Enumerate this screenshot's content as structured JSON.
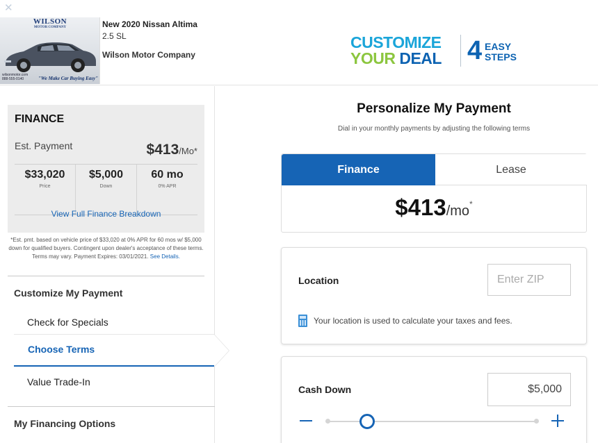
{
  "header": {
    "close_symbol": "✕",
    "dealer_logo_text": "WILSON",
    "dealer_logo_subtext": "MOTOR COMPANY",
    "dealer_site": "wilsonmotor.com",
    "dealer_phone": "888-555-0140",
    "dealer_slogan": "\"We Make Car Buying Easy\"",
    "vehicle_title": "New 2020 Nissan Altima",
    "vehicle_trim": "2.5 SL",
    "dealer_name": "Wilson Motor Company",
    "brand": {
      "customize": "CUSTOMIZE",
      "your": "YOUR",
      "deal": "DEAL",
      "four": "4",
      "easy": "EASY",
      "steps": "STEPS"
    }
  },
  "sidebar": {
    "finance_title": "FINANCE",
    "est_label": "Est. Payment",
    "est_value": "$413",
    "est_unit": "/Mo*",
    "stats": [
      {
        "value": "$33,020",
        "label": "Price"
      },
      {
        "value": "$5,000",
        "label": "Down"
      },
      {
        "value": "60 mo",
        "label": "0% APR"
      }
    ],
    "breakdown_link": "View Full Finance Breakdown",
    "disclaimer": "*Est. pmt. based on vehicle price of $33,020 at 0% APR for 60 mos w/ $5,000 down for qualified buyers. Contingent upon dealer's acceptance of these terms. Terms may vary. Payment Expires: 03/01/2021.",
    "disclaimer_link": "See Details.",
    "customize_heading": "Customize My Payment",
    "nav": {
      "specials": "Check for Specials",
      "terms": "Choose Terms",
      "tradein": "Value Trade-In"
    },
    "financing_options": "My Financing Options"
  },
  "main": {
    "title": "Personalize My Payment",
    "subtitle": "Dial in your monthly payments by adjusting the following terms",
    "tabs": {
      "finance": "Finance",
      "lease": "Lease"
    },
    "payment_value": "$413",
    "payment_unit": "/mo",
    "payment_asterisk": "*",
    "location": {
      "label": "Location",
      "zip_placeholder": "Enter ZIP",
      "note": "Your location is used to calculate your taxes and fees."
    },
    "cash_down": {
      "label": "Cash Down",
      "value": "$5,000",
      "slider_fraction": 0.19
    }
  },
  "colors": {
    "accent": "#1664b5",
    "brand_light_blue": "#1aa5d9",
    "brand_green": "#8cc63f",
    "panel_gray": "#ececec"
  },
  "icons": {
    "close": "close-icon",
    "calculator": "calculator-icon",
    "minus": "minus-icon",
    "plus": "plus-icon"
  }
}
